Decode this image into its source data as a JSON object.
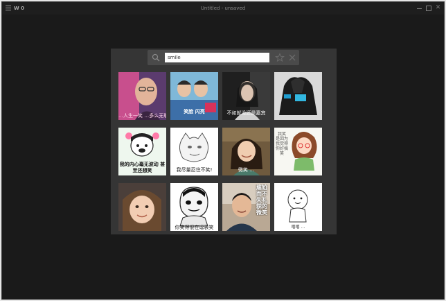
{
  "window": {
    "app_name": "W 0",
    "title": "Untitled - unsaved"
  },
  "search": {
    "value": "smile",
    "icon": "search-icon"
  },
  "icons": {
    "favorite": "star-icon",
    "clear": "close-icon"
  },
  "results": [
    {
      "caption": "…人生一笑 …多么无聊的笑"
    },
    {
      "caption": "笑脸 闪亮"
    },
    {
      "caption": "不如就没还是嘉宾"
    },
    {
      "caption": ""
    },
    {
      "caption": "我的内心毫无波动 甚至还想笑"
    },
    {
      "caption": "我尽量忍住不笑!"
    },
    {
      "caption": "微笑 …"
    },
    {
      "caption": "我笑 是因为 我觉得 你好搞笑"
    },
    {
      "caption": ""
    },
    {
      "caption": "你笑得很在逗表笑"
    },
    {
      "caption": "尴尬而不失礼貌的微笑"
    },
    {
      "caption": "嘻嘻 …"
    }
  ]
}
